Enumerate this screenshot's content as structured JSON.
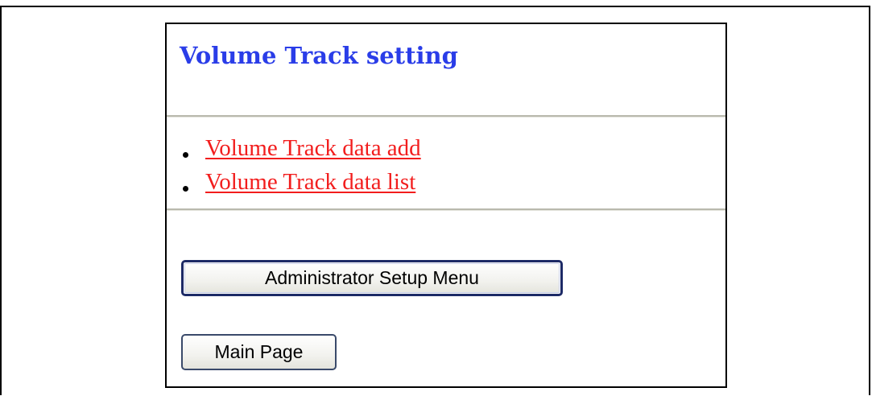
{
  "page": {
    "title": "Volume Track setting"
  },
  "links": [
    {
      "label": "Volume Track data add"
    },
    {
      "label": "Volume Track data list"
    }
  ],
  "buttons": {
    "admin_menu_label": "Administrator Setup Menu",
    "main_page_label": "Main Page"
  },
  "colors": {
    "title": "#2a3de8",
    "link": "#f21d1d",
    "button_border": "#1d2a66"
  }
}
